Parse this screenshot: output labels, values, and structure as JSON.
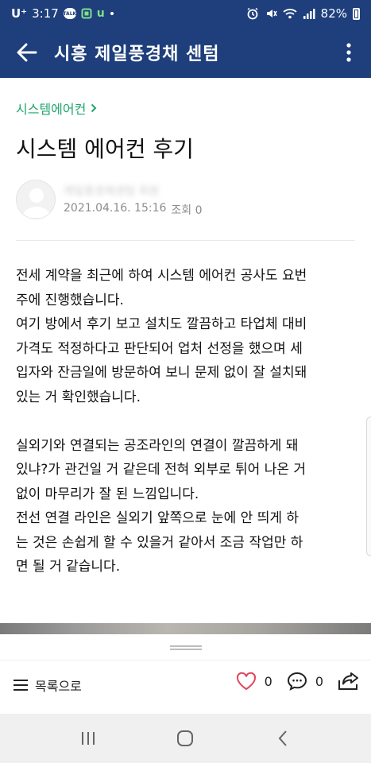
{
  "status_bar": {
    "carrier": "U⁺",
    "time": "3:17",
    "talk_badge": "TALK",
    "battery": "82%"
  },
  "app_bar": {
    "title": "시흥 제일풍경채 센텀"
  },
  "post": {
    "category": "시스템에어컨",
    "title": "시스템 에어컨 후기",
    "author_blurred": "제일풍경채센텀 회원",
    "date": "2021.04.16. 15:16",
    "views_label": "조회 0",
    "body_lines": [
      "전세 계약을 최근에 하여 시스템 에어컨 공사도 요번",
      "주에 진행했습니다.",
      "여기 방에서 후기 보고 설치도 깔끔하고 타업체 대비",
      "가격도 적정하다고 판단되어 업처 선정을 했으며 세",
      "입자와 잔금일에 방문하여 보니 문제 없이 잘 설치돼",
      "있는 거 확인했습니다.",
      "",
      "실외기와 연결되는 공조라인의 연결이 깔끔하게 돼",
      "있냐?가 관건일 거 같은데 전혀 외부로 튀어 나온 거",
      "없이 마무리가 잘 된 느낌입니다.",
      "전선 연결 라인은 실외기 앞쪽으로 눈에 안 띄게 하",
      "는 것은 손쉽게 할 수 있을거 같아서 조금 작업만 하",
      "면 될 거 같습니다."
    ]
  },
  "bottom_bar": {
    "list_label": "목록으로",
    "like_count": "0",
    "comment_count": "0"
  },
  "icons": {
    "back": "arrow-left-icon",
    "more": "more-vertical-icon",
    "list": "menu-icon",
    "like": "heart-icon",
    "comment": "comment-icon",
    "share": "share-icon"
  },
  "colors": {
    "app_bar": "#1e3f7c",
    "category": "#1fa56c",
    "like": "#e0475c"
  }
}
